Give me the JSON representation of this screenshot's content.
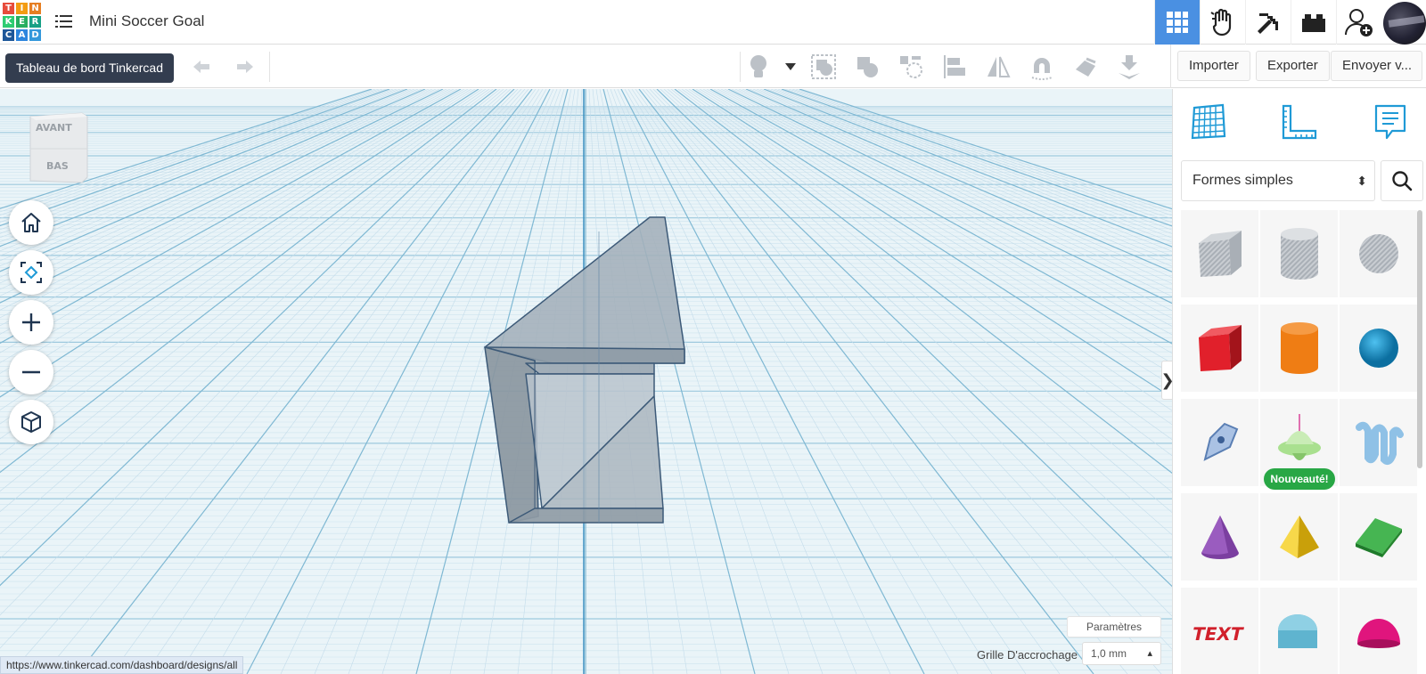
{
  "app": {
    "logo_letters": [
      "T",
      "I",
      "N",
      "K",
      "E",
      "R",
      "C",
      "A",
      "D"
    ],
    "logo_colors": [
      "#e74c3c",
      "#f39c12",
      "#e67e22",
      "#2ecc71",
      "#27ae60",
      "#16a085",
      "#1e5799",
      "#2e86de",
      "#3498db"
    ],
    "design_title": "Mini Soccer Goal"
  },
  "header": {
    "icons": [
      "grid-view-icon",
      "gallery-hand-icon",
      "pickaxe-minecraft-icon",
      "brick-lego-icon",
      "add-user-icon",
      "user-avatar"
    ],
    "active_icon": "grid-view-icon",
    "accent_color": "#4a90e2"
  },
  "toolbar": {
    "tooltip": "Tableau de bord Tinkercad",
    "tools": [
      "light-bulb-icon",
      "dropdown-icon",
      "group-icon",
      "ungroup-icon",
      "cruise-icon",
      "align-icon",
      "mirror-icon",
      "workplane-magnet-icon",
      "hide-icon",
      "drop-to-workplane-icon"
    ],
    "import_label": "Importer",
    "export_label": "Exporter",
    "send_label": "Envoyer v..."
  },
  "viewcube": {
    "front_label": "AVANT",
    "bottom_label": "BAS"
  },
  "nav_controls": [
    "home-view-icon",
    "fit-view-icon",
    "zoom-in-icon",
    "zoom-out-icon",
    "ortho-view-icon"
  ],
  "workplane": {
    "params_label": "Paramètres",
    "snap_label": "Grille D'accrochage",
    "snap_value": "1,0 mm",
    "status_url": "https://www.tinkercad.com/dashboard/designs/all",
    "collapse_label": "❯"
  },
  "panel": {
    "tabs": [
      "workplane-grid-icon",
      "ruler-icon",
      "notes-icon"
    ],
    "category_value": "Formes simples",
    "shapes": [
      {
        "name": "box-hole",
        "color": "#b7bcc2"
      },
      {
        "name": "cylinder-hole",
        "color": "#b7bcc2"
      },
      {
        "name": "sphere-hole",
        "color": "#b7bcc2"
      },
      {
        "name": "box",
        "color": "#e1202b"
      },
      {
        "name": "cylinder",
        "color": "#ef7d14"
      },
      {
        "name": "sphere",
        "color": "#1b95d0"
      },
      {
        "name": "scribble",
        "color": "#7d9cc8"
      },
      {
        "name": "spinning-top",
        "color": "#a9e08f"
      },
      {
        "name": "text-waves",
        "color": "#8fc1e6"
      },
      {
        "name": "cone",
        "color": "#7b3fa0"
      },
      {
        "name": "pyramid",
        "color": "#f0c612"
      },
      {
        "name": "roof",
        "color": "#2e9b3c"
      },
      {
        "name": "text",
        "color": "#d1202b"
      },
      {
        "name": "half-cylinder",
        "color": "#5fb4cf"
      },
      {
        "name": "half-sphere",
        "color": "#e0157d"
      }
    ],
    "new_badge": "Nouveauté!"
  }
}
